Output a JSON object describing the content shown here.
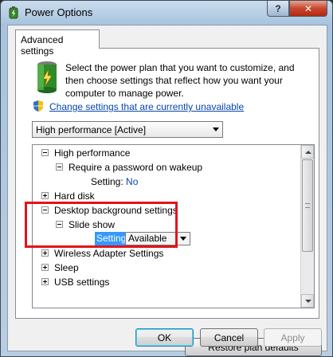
{
  "window": {
    "title": "Power Options",
    "help_label": "?",
    "close_label": "✕"
  },
  "tab": {
    "label": "Advanced settings"
  },
  "intro": {
    "text": "Select the power plan that you want to customize, and then choose settings that reflect how you want your computer to manage power."
  },
  "change_link": "Change settings that are currently unavailable",
  "plan_select": {
    "value": "High performance [Active]"
  },
  "tree": {
    "nodes": [
      {
        "label": "High performance",
        "expander": "minus"
      },
      {
        "label": "Require a password on wakeup",
        "expander": "minus"
      },
      {
        "label": "Setting:",
        "value": "No"
      },
      {
        "label": "Hard disk",
        "expander": "plus"
      },
      {
        "label": "Desktop background settings",
        "expander": "minus"
      },
      {
        "label": "Slide show",
        "expander": "minus"
      },
      {
        "label": "Setting:",
        "value": "Available"
      },
      {
        "label": "Wireless Adapter Settings",
        "expander": "plus"
      },
      {
        "label": "Sleep",
        "expander": "plus"
      },
      {
        "label": "USB settings",
        "expander": "plus"
      }
    ]
  },
  "buttons": {
    "restore": "Restore plan defaults",
    "ok": "OK",
    "cancel": "Cancel",
    "apply": "Apply"
  },
  "colors": {
    "highlight": "#e0141b",
    "link": "#0645ad",
    "selection": "#3399ff"
  }
}
